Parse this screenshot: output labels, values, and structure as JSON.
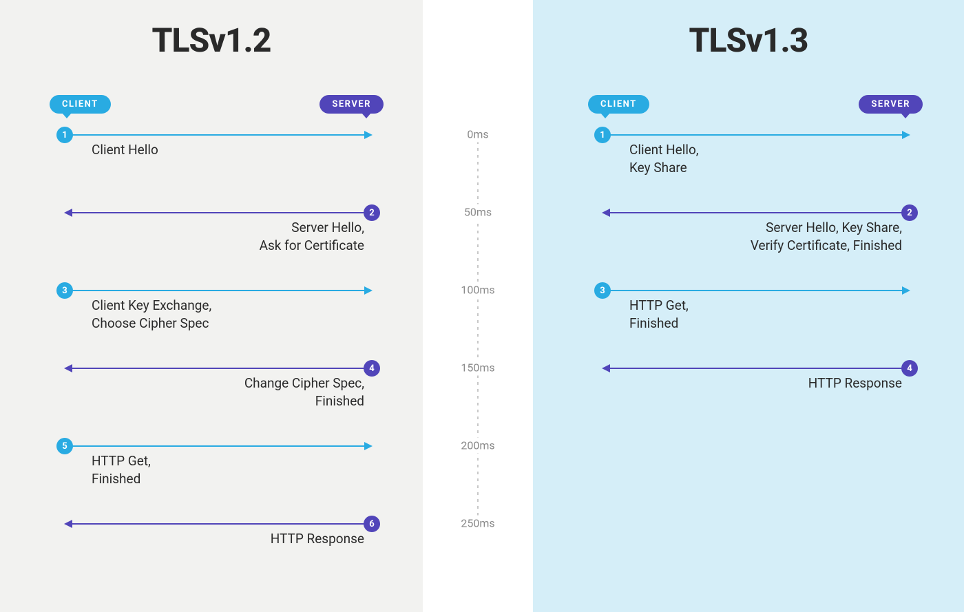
{
  "timeline": {
    "ticks": [
      "0ms",
      "50ms",
      "100ms",
      "150ms",
      "200ms",
      "250ms"
    ]
  },
  "left": {
    "title": "TLSv1.2",
    "client_label": "CLIENT",
    "server_label": "SERVER",
    "steps": [
      {
        "n": "1",
        "dir": "client",
        "text": "Client Hello"
      },
      {
        "n": "2",
        "dir": "server",
        "text": "Server Hello,\nAsk for Certificate"
      },
      {
        "n": "3",
        "dir": "client",
        "text": "Client Key Exchange,\nChoose Cipher Spec"
      },
      {
        "n": "4",
        "dir": "server",
        "text": "Change Cipher Spec,\nFinished"
      },
      {
        "n": "5",
        "dir": "client",
        "text": "HTTP Get,\nFinished"
      },
      {
        "n": "6",
        "dir": "server",
        "text": "HTTP Response"
      }
    ]
  },
  "right": {
    "title": "TLSv1.3",
    "client_label": "CLIENT",
    "server_label": "SERVER",
    "steps": [
      {
        "n": "1",
        "dir": "client",
        "text": "Client Hello,\nKey Share"
      },
      {
        "n": "2",
        "dir": "server",
        "text": "Server Hello, Key Share,\nVerify Certificate, Finished"
      },
      {
        "n": "3",
        "dir": "client",
        "text": "HTTP Get,\nFinished"
      },
      {
        "n": "4",
        "dir": "server",
        "text": "HTTP Response"
      }
    ]
  },
  "chart_data": [
    {
      "type": "sequence",
      "title": "TLSv1.2",
      "actors": [
        "CLIENT",
        "SERVER"
      ],
      "messages": [
        {
          "step": 1,
          "from": "CLIENT",
          "to": "SERVER",
          "time_ms": 0,
          "label": "Client Hello"
        },
        {
          "step": 2,
          "from": "SERVER",
          "to": "CLIENT",
          "time_ms": 50,
          "label": "Server Hello, Ask for Certificate"
        },
        {
          "step": 3,
          "from": "CLIENT",
          "to": "SERVER",
          "time_ms": 100,
          "label": "Client Key Exchange, Choose Cipher Spec"
        },
        {
          "step": 4,
          "from": "SERVER",
          "to": "CLIENT",
          "time_ms": 150,
          "label": "Change Cipher Spec, Finished"
        },
        {
          "step": 5,
          "from": "CLIENT",
          "to": "SERVER",
          "time_ms": 200,
          "label": "HTTP Get, Finished"
        },
        {
          "step": 6,
          "from": "SERVER",
          "to": "CLIENT",
          "time_ms": 250,
          "label": "HTTP Response"
        }
      ]
    },
    {
      "type": "sequence",
      "title": "TLSv1.3",
      "actors": [
        "CLIENT",
        "SERVER"
      ],
      "messages": [
        {
          "step": 1,
          "from": "CLIENT",
          "to": "SERVER",
          "time_ms": 0,
          "label": "Client Hello, Key Share"
        },
        {
          "step": 2,
          "from": "SERVER",
          "to": "CLIENT",
          "time_ms": 50,
          "label": "Server Hello, Key Share, Verify Certificate, Finished"
        },
        {
          "step": 3,
          "from": "CLIENT",
          "to": "SERVER",
          "time_ms": 100,
          "label": "HTTP Get, Finished"
        },
        {
          "step": 4,
          "from": "SERVER",
          "to": "CLIENT",
          "time_ms": 150,
          "label": "HTTP Response"
        }
      ]
    }
  ]
}
